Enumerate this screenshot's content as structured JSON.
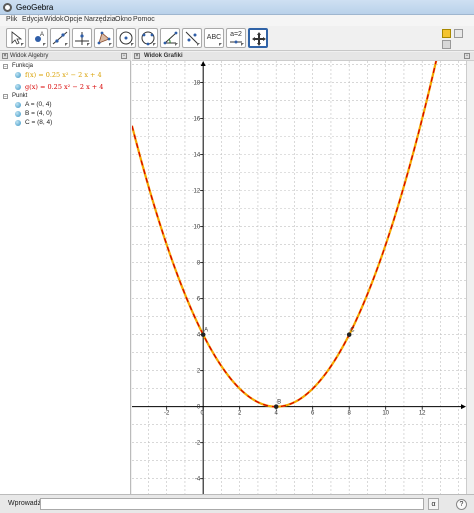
{
  "window": {
    "title": "GeoGebra"
  },
  "menu": [
    "Plik",
    "Edycja",
    "Widok",
    "Opcje",
    "Narzędzia",
    "Okno",
    "Pomoc"
  ],
  "toolbar": {
    "tools": [
      {
        "name": "move-tool",
        "icon": "cursor-arrow"
      },
      {
        "name": "point-tool",
        "icon": "point"
      },
      {
        "name": "line-tool",
        "icon": "line-through-two-points"
      },
      {
        "name": "perpendicular-line-tool",
        "icon": "perpendicular-line"
      },
      {
        "name": "polygon-tool",
        "icon": "polygon"
      },
      {
        "name": "circle-tool",
        "icon": "circle-center-point"
      },
      {
        "name": "ellipse-tool",
        "icon": "ellipse"
      },
      {
        "name": "angle-tool",
        "icon": "angle"
      },
      {
        "name": "reflect-tool",
        "icon": "reflect-about-line"
      },
      {
        "name": "text-tool",
        "icon": "text",
        "label": "ABC"
      },
      {
        "name": "slider-tool",
        "icon": "slider",
        "label": "a=2"
      },
      {
        "name": "move-graphics-view-tool",
        "icon": "move-arrows",
        "active": true
      }
    ]
  },
  "algebra": {
    "header": "Widok Algebry",
    "categories": [
      {
        "label": "Funkcja",
        "items": [
          {
            "text": "f(x) = 0.25 x² − 2 x + 4",
            "color": "#d9a000"
          },
          {
            "text": "g(x) = 0.25 x² − 2 x + 4",
            "color": "#d80000"
          }
        ]
      },
      {
        "label": "Punkt",
        "items": [
          {
            "text": "A = (0, 4)"
          },
          {
            "text": "B = (4, 0)"
          },
          {
            "text": "C = (8, 4)"
          }
        ]
      }
    ]
  },
  "graphics": {
    "header": "Widok Grafiki",
    "xrange": [
      -3.9,
      14.4
    ],
    "yrange": [
      -4.85,
      19.2
    ],
    "x_ticks": [
      "-2",
      "0",
      "2",
      "4",
      "6",
      "8",
      "10",
      "12"
    ],
    "y_ticks": [
      "-4",
      "-2",
      "0",
      "2",
      "4",
      "6",
      "8",
      "10",
      "12",
      "14",
      "16",
      "18"
    ],
    "function": {
      "expr": "0.25x^2 - 2x + 4",
      "color_f": "#f5a800",
      "color_g": "#d80000"
    },
    "points": [
      {
        "label": "A",
        "x": 0,
        "y": 4
      },
      {
        "label": "B",
        "x": 4,
        "y": 0
      },
      {
        "label": "C",
        "x": 8,
        "y": 4
      }
    ]
  },
  "input": {
    "label": "Wprowadź:",
    "value": "",
    "alpha_symbol": "α",
    "help_symbol": "?"
  },
  "colors": {
    "accent": "#3063a7"
  }
}
